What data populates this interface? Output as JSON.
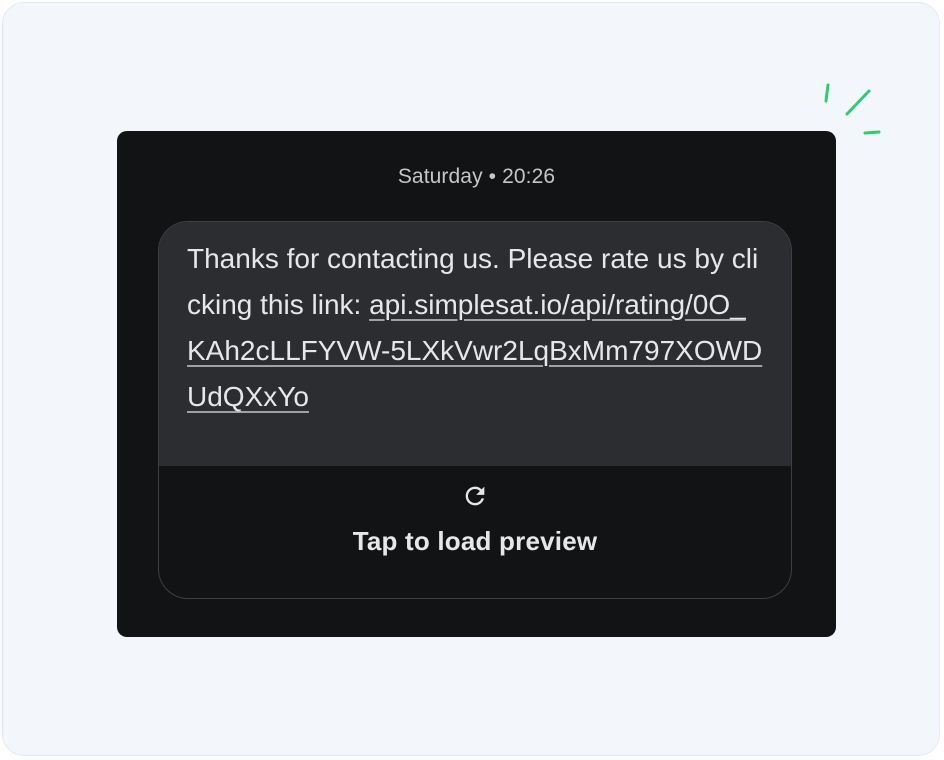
{
  "conversation": {
    "timestamp_day": "Saturday",
    "timestamp_separator": "•",
    "timestamp_time": "20:26"
  },
  "message": {
    "text_before_link": "Thanks for contacting us. Please rate us by clicking this link: ",
    "link_text": "api.simplesat.io/api/rating/0O_KAh2cLLFYVW-5LXkVwr2LqBxMm797XOWDUdQXxYo"
  },
  "preview": {
    "label": "Tap to load preview",
    "icon": "refresh-icon"
  },
  "colors": {
    "outer_background": "#f3f6fb",
    "panel_background": "#111315",
    "bubble_background": "#2b2d31",
    "text": "#e6e7e9",
    "timestamp_text": "#c4c7c9",
    "sparkle_accent": "#2ecc71"
  }
}
